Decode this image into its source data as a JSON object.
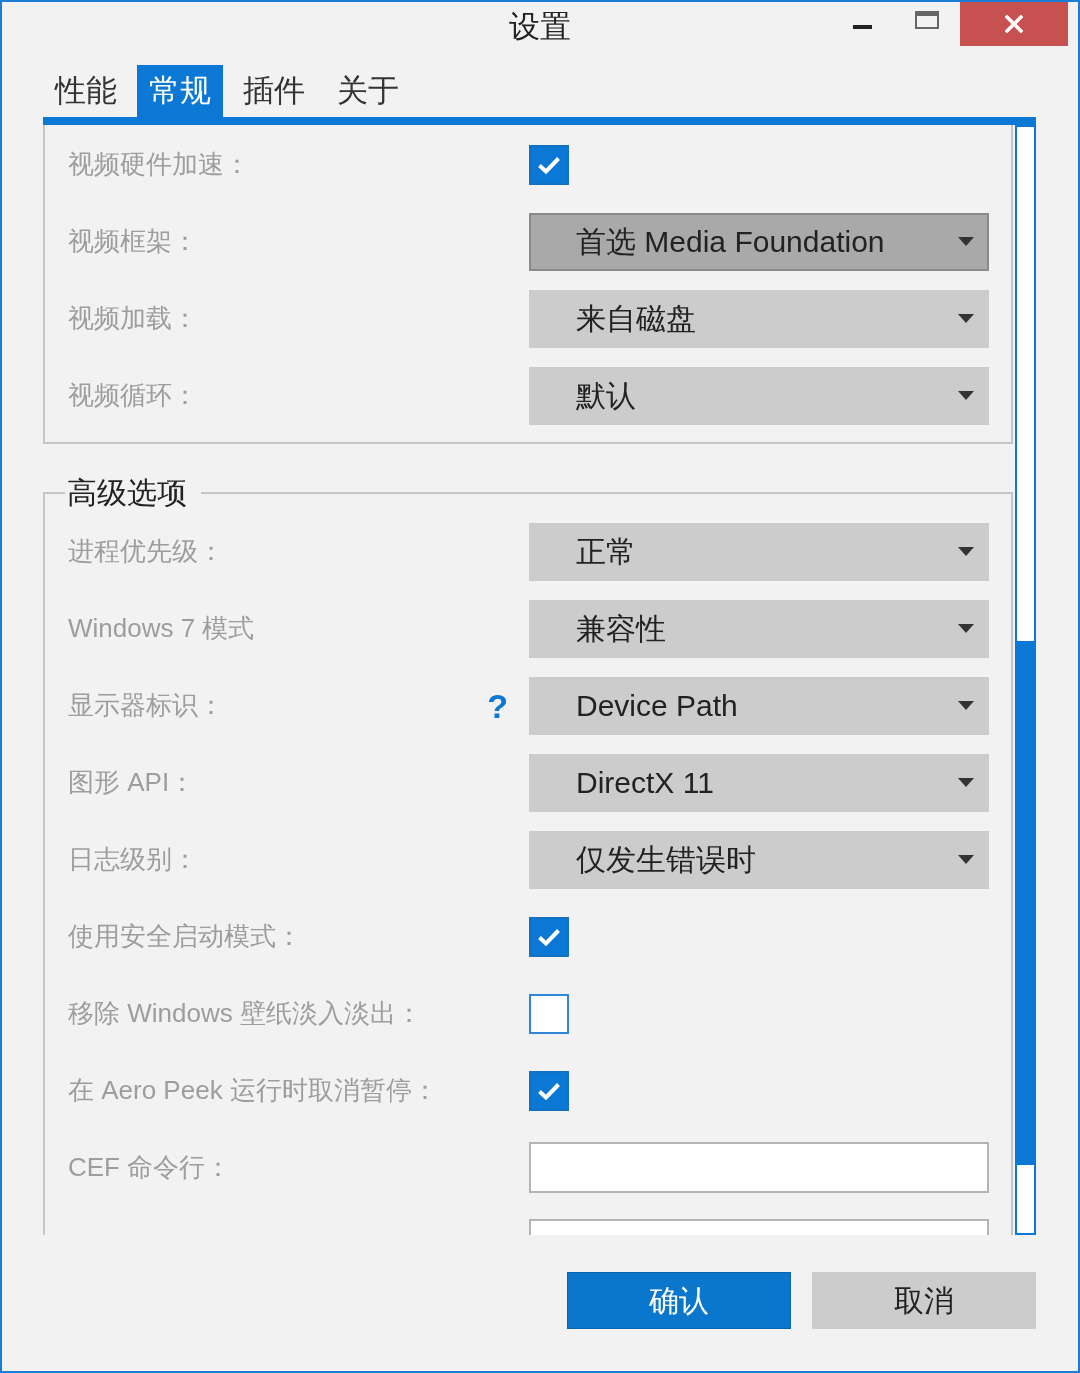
{
  "window": {
    "title": "设置"
  },
  "tabs": [
    {
      "label": "性能",
      "selected": false
    },
    {
      "label": "常规",
      "selected": true
    },
    {
      "label": "插件",
      "selected": false
    },
    {
      "label": "关于",
      "selected": false
    }
  ],
  "general": {
    "settings": [
      {
        "kind": "checkbox",
        "label": "视频硬件加速：",
        "checked": true
      },
      {
        "kind": "dropdown",
        "label": "视频框架：",
        "value": "首选 Media Foundation",
        "highlighted": true
      },
      {
        "kind": "dropdown",
        "label": "视频加载：",
        "value": "来自磁盘",
        "highlighted": false
      },
      {
        "kind": "dropdown",
        "label": "视频循环：",
        "value": "默认",
        "highlighted": false
      }
    ]
  },
  "advanced": {
    "title": "高级选项",
    "settings": [
      {
        "kind": "dropdown",
        "label": "进程优先级：",
        "value": "正常",
        "highlighted": false
      },
      {
        "kind": "dropdown",
        "label": "Windows 7 模式",
        "value": "兼容性",
        "highlighted": false
      },
      {
        "kind": "dropdown",
        "label": "显示器标识：",
        "help": "?",
        "value": "Device Path",
        "highlighted": false
      },
      {
        "kind": "dropdown",
        "label": "图形 API：",
        "value": "DirectX 11",
        "highlighted": false
      },
      {
        "kind": "dropdown",
        "label": "日志级别：",
        "value": "仅发生错误时",
        "highlighted": false
      },
      {
        "kind": "checkbox",
        "label": "使用安全启动模式：",
        "checked": true
      },
      {
        "kind": "checkbox",
        "label": "移除 Windows 壁纸淡入淡出：",
        "checked": false
      },
      {
        "kind": "checkbox",
        "label": "在 Aero Peek 运行时取消暂停：",
        "checked": true
      },
      {
        "kind": "text",
        "label": "CEF 命令行："
      },
      {
        "kind": "text"
      }
    ]
  },
  "buttons": [
    {
      "label": "确认",
      "kind": "primary"
    },
    {
      "label": "取消",
      "kind": "secondary"
    }
  ]
}
